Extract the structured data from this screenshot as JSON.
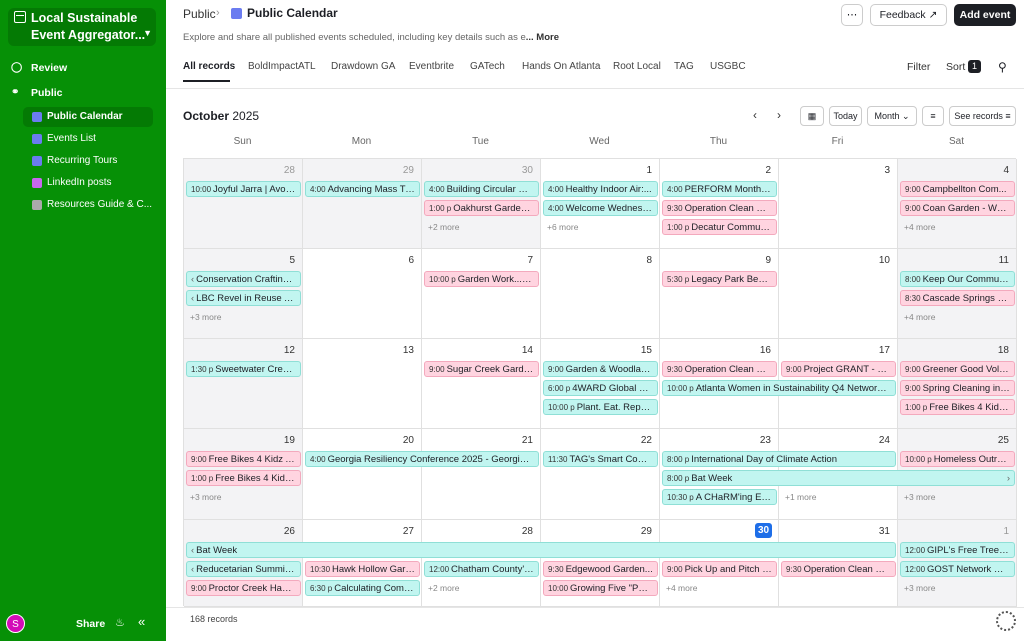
{
  "sidebar": {
    "base_title": "Local Sustainable Event Aggregator...",
    "review": "Review",
    "public": "Public",
    "tables": [
      "Public Calendar",
      "Events List",
      "Recurring Tours",
      "LinkedIn posts",
      "Resources Guide & C..."
    ],
    "avatar_initial": "S",
    "share": "Share"
  },
  "header": {
    "crumb": "Public",
    "title": "Public Calendar",
    "description": "Explore and share all published events scheduled, including key details such as e",
    "description_more": "... More",
    "dots": "⋯",
    "feedback": "Feedback",
    "add_event": "Add event"
  },
  "tabs": [
    "All records",
    "BoldImpactATL",
    "Drawdown GA",
    "Eventbrite",
    "GATech",
    "Hands On Atlanta",
    "Root Local",
    "TAG",
    "USGBC"
  ],
  "toolbar": {
    "filter": "Filter",
    "sort": "Sort",
    "sort_count": "1",
    "month": "October",
    "year": "2025",
    "today": "Today",
    "view": "Month",
    "see_records": "See records"
  },
  "days": [
    "Sun",
    "Mon",
    "Tue",
    "Wed",
    "Thu",
    "Fri",
    "Sat"
  ],
  "weeks": [
    {
      "nums": [
        "28",
        "29",
        "30",
        "1",
        "2",
        "3",
        "4"
      ],
      "muted": [
        true,
        true,
        true,
        false,
        false,
        false,
        false
      ]
    },
    {
      "nums": [
        "5",
        "6",
        "7",
        "8",
        "9",
        "10",
        "11"
      ]
    },
    {
      "nums": [
        "12",
        "13",
        "14",
        "15",
        "16",
        "17",
        "18"
      ]
    },
    {
      "nums": [
        "19",
        "20",
        "21",
        "22",
        "23",
        "24",
        "25"
      ]
    },
    {
      "nums": [
        "26",
        "27",
        "28",
        "29",
        "30",
        "31",
        "1"
      ],
      "muted": [
        false,
        false,
        false,
        false,
        false,
        false,
        true
      ],
      "today_index": 4
    }
  ],
  "events": [
    {
      "w": 0,
      "d": 0,
      "span": 1,
      "row": 0,
      "color": "teal",
      "time": "10:00",
      "title": "Joyful Jarra | Avon..."
    },
    {
      "w": 0,
      "d": 1,
      "span": 1,
      "row": 0,
      "color": "teal",
      "time": "4:00",
      "title": "Advancing Mass Ti..."
    },
    {
      "w": 0,
      "d": 2,
      "span": 1,
      "row": 0,
      "color": "teal",
      "time": "4:00",
      "title": "Building Circular Ec..."
    },
    {
      "w": 0,
      "d": 2,
      "span": 1,
      "row": 1,
      "color": "pink",
      "time": "1:00 p",
      "title": "Oakhurst Garden -..."
    },
    {
      "w": 0,
      "d": 3,
      "span": 1,
      "row": 0,
      "color": "teal",
      "time": "4:00",
      "title": "Healthy Indoor Air:..."
    },
    {
      "w": 0,
      "d": 3,
      "span": 1,
      "row": 1,
      "color": "teal",
      "time": "4:00",
      "title": "Welcome Wednesd..."
    },
    {
      "w": 0,
      "d": 4,
      "span": 1,
      "row": 0,
      "color": "teal",
      "time": "4:00",
      "title": "PERFORM Monthly ..."
    },
    {
      "w": 0,
      "d": 4,
      "span": 1,
      "row": 1,
      "color": "pink",
      "time": "9:30",
      "title": "Operation Clean Sw..."
    },
    {
      "w": 0,
      "d": 4,
      "span": 1,
      "row": 2,
      "color": "pink",
      "time": "1:00 p",
      "title": "Decatur Communi..."
    },
    {
      "w": 0,
      "d": 6,
      "span": 1,
      "row": 0,
      "color": "pink",
      "time": "9:00",
      "title": "Campbellton Com..."
    },
    {
      "w": 0,
      "d": 6,
      "span": 1,
      "row": 1,
      "color": "pink",
      "time": "9:00",
      "title": "Coan Garden - Wyld..."
    },
    {
      "w": 1,
      "d": 0,
      "span": 1,
      "row": 0,
      "color": "teal",
      "cont": true,
      "title": "Conservation Crafting: ..."
    },
    {
      "w": 1,
      "d": 0,
      "span": 1,
      "row": 1,
      "color": "teal",
      "cont": true,
      "title": "LBC Revel in Reuse An..."
    },
    {
      "w": 1,
      "d": 2,
      "span": 1,
      "row": 0,
      "color": "pink",
      "time": "10:00 p",
      "title": "Garden Work...",
      "warn": true
    },
    {
      "w": 1,
      "d": 4,
      "span": 1,
      "row": 0,
      "color": "pink",
      "time": "5:30 p",
      "title": "Legacy Park Beauti..."
    },
    {
      "w": 1,
      "d": 6,
      "span": 1,
      "row": 0,
      "color": "teal",
      "time": "8:00",
      "title": "Keep Our Communi..."
    },
    {
      "w": 1,
      "d": 6,
      "span": 1,
      "row": 1,
      "color": "pink",
      "time": "8:30",
      "title": "Cascade Springs Na..."
    },
    {
      "w": 2,
      "d": 0,
      "span": 1,
      "row": 0,
      "color": "teal",
      "time": "1:30 p",
      "title": "Sweetwater Creek ..."
    },
    {
      "w": 2,
      "d": 2,
      "span": 1,
      "row": 0,
      "color": "pink",
      "time": "9:00",
      "title": "Sugar Creek Garde..."
    },
    {
      "w": 2,
      "d": 3,
      "span": 1,
      "row": 0,
      "color": "teal",
      "time": "9:00",
      "title": "Garden & Woodlan..."
    },
    {
      "w": 2,
      "d": 3,
      "span": 1,
      "row": 1,
      "color": "teal",
      "time": "6:00 p",
      "title": "4WARD Global Cli..."
    },
    {
      "w": 2,
      "d": 3,
      "span": 1,
      "row": 2,
      "color": "teal",
      "time": "10:00 p",
      "title": "Plant. Eat. Repeat..."
    },
    {
      "w": 2,
      "d": 4,
      "span": 1,
      "row": 0,
      "color": "pink",
      "time": "9:30",
      "title": "Operation Clean Sw..."
    },
    {
      "w": 2,
      "d": 4,
      "span": 2,
      "row": 1,
      "color": "teal",
      "time": "10:00 p",
      "title": "Atlanta Women in Sustainability Q4 Networkin..."
    },
    {
      "w": 2,
      "d": 5,
      "span": 1,
      "row": 0,
      "color": "pink",
      "time": "9:00",
      "title": "Project GRANT - Oc..."
    },
    {
      "w": 2,
      "d": 6,
      "span": 1,
      "row": 0,
      "color": "pink",
      "time": "9:00",
      "title": "Greener Good Volu..."
    },
    {
      "w": 2,
      "d": 6,
      "span": 1,
      "row": 1,
      "color": "pink",
      "time": "9:00",
      "title": "Spring Cleaning in ..."
    },
    {
      "w": 2,
      "d": 6,
      "span": 1,
      "row": 2,
      "color": "pink",
      "time": "1:00 p",
      "title": "Free Bikes 4 Kidz A..."
    },
    {
      "w": 3,
      "d": 0,
      "span": 1,
      "row": 0,
      "color": "pink",
      "time": "9:00",
      "title": "Free Bikes 4 Kidz At..."
    },
    {
      "w": 3,
      "d": 0,
      "span": 1,
      "row": 1,
      "color": "pink",
      "time": "1:00 p",
      "title": "Free Bikes 4 Kidz A..."
    },
    {
      "w": 3,
      "d": 1,
      "span": 2,
      "row": 0,
      "color": "teal",
      "time": "4:00",
      "title": "Georgia Resiliency Conference 2025 - Georgia D..."
    },
    {
      "w": 3,
      "d": 3,
      "span": 1,
      "row": 0,
      "color": "teal",
      "time": "11:30",
      "title": "TAG's Smart Com..."
    },
    {
      "w": 3,
      "d": 4,
      "span": 2,
      "row": 0,
      "color": "teal",
      "time": "8:00 p",
      "title": "International Day of Climate Action"
    },
    {
      "w": 3,
      "d": 4,
      "span": 3,
      "row": 1,
      "color": "teal",
      "time": "8:00 p",
      "title": "Bat Week",
      "arrow": true
    },
    {
      "w": 3,
      "d": 4,
      "span": 1,
      "row": 2,
      "color": "teal",
      "time": "10:30 p",
      "title": "A CHaRM'ing Eve..."
    },
    {
      "w": 3,
      "d": 6,
      "span": 1,
      "row": 0,
      "color": "pink",
      "time": "10:00 p",
      "title": "Homeless Outreac..."
    },
    {
      "w": 4,
      "d": 0,
      "span": 6,
      "row": 0,
      "color": "teal",
      "cont": true,
      "title": "Bat Week"
    },
    {
      "w": 4,
      "d": 0,
      "span": 1,
      "row": 1,
      "color": "teal",
      "cont": true,
      "title": "Reducetarian Summit ..."
    },
    {
      "w": 4,
      "d": 0,
      "span": 1,
      "row": 2,
      "color": "pink",
      "time": "9:00",
      "title": "Proctor Creek Habit..."
    },
    {
      "w": 4,
      "d": 1,
      "span": 1,
      "row": 1,
      "color": "pink",
      "time": "10:30",
      "title": "Hawk Hollow Gard..."
    },
    {
      "w": 4,
      "d": 1,
      "span": 1,
      "row": 2,
      "color": "teal",
      "time": "6:30 p",
      "title": "Calculating Comp..."
    },
    {
      "w": 4,
      "d": 2,
      "span": 1,
      "row": 1,
      "color": "teal",
      "time": "12:00",
      "title": "Chatham County's ..."
    },
    {
      "w": 4,
      "d": 3,
      "span": 1,
      "row": 1,
      "color": "pink",
      "time": "9:30",
      "title": "Edgewood Garden..."
    },
    {
      "w": 4,
      "d": 3,
      "span": 1,
      "row": 2,
      "color": "pink",
      "time": "10:00",
      "title": "Growing Five \"Poin..."
    },
    {
      "w": 4,
      "d": 4,
      "span": 1,
      "row": 1,
      "color": "pink",
      "time": "9:00",
      "title": "Pick Up and Pitch In..."
    },
    {
      "w": 4,
      "d": 5,
      "span": 1,
      "row": 1,
      "color": "pink",
      "time": "9:30",
      "title": "Operation Clean Sw..."
    },
    {
      "w": 4,
      "d": 6,
      "span": 1,
      "row": 0,
      "color": "teal",
      "time": "12:00",
      "title": "GIPL's Free Tree A..."
    },
    {
      "w": 4,
      "d": 6,
      "span": 1,
      "row": 1,
      "color": "teal",
      "time": "12:00",
      "title": "GOST Network Res..."
    }
  ],
  "mores": [
    {
      "w": 0,
      "d": 2,
      "row": 2,
      "text": "+2 more"
    },
    {
      "w": 0,
      "d": 3,
      "row": 2,
      "text": "+6 more"
    },
    {
      "w": 0,
      "d": 6,
      "row": 2,
      "text": "+4 more"
    },
    {
      "w": 1,
      "d": 0,
      "row": 2,
      "text": "+3 more"
    },
    {
      "w": 1,
      "d": 6,
      "row": 2,
      "text": "+4 more"
    },
    {
      "w": 3,
      "d": 0,
      "row": 2,
      "text": "+3 more"
    },
    {
      "w": 3,
      "d": 5,
      "row": 2,
      "text": "+1 more"
    },
    {
      "w": 3,
      "d": 6,
      "row": 2,
      "text": "+3 more"
    },
    {
      "w": 4,
      "d": 2,
      "row": 2,
      "text": "+2 more"
    },
    {
      "w": 4,
      "d": 4,
      "row": 2,
      "text": "+4 more"
    },
    {
      "w": 4,
      "d": 6,
      "row": 2,
      "text": "+3 more"
    }
  ],
  "footer": {
    "records": "168 records"
  },
  "colors": {
    "sidebar": "#069006",
    "teal": "#c1f5f0",
    "pink": "#ffd4e0",
    "today": "#1e6ee8"
  },
  "table_icon_colors": [
    "#6b7cf0",
    "#6b7cf0",
    "#6b7cf0",
    "#c868f0",
    "#aaaaaa"
  ]
}
